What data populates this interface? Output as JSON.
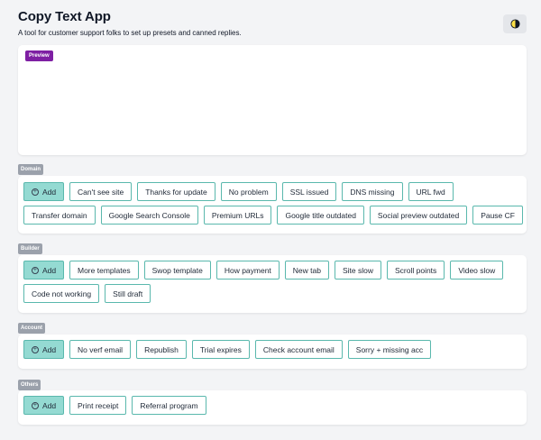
{
  "header": {
    "title": "Copy Text App",
    "subtitle": "A tool for customer support folks to set up presets and canned replies."
  },
  "theme_toggle": {
    "icon": "half-moon-icon"
  },
  "preview": {
    "badge": "Preview",
    "content": ""
  },
  "add_label": "Add",
  "sections": {
    "domain": {
      "label": "Domain",
      "buttons": [
        "Can't see site",
        "Thanks for update",
        "No problem",
        "SSL issued",
        "DNS missing",
        "URL fwd",
        "Transfer domain",
        "Google Search Console",
        "Premium URLs",
        "Google title outdated",
        "Social preview outdated",
        "Pause CF"
      ]
    },
    "builder": {
      "label": "Builder",
      "buttons": [
        "More templates",
        "Swop template",
        "How payment",
        "New tab",
        "Site slow",
        "Scroll points",
        "Video slow",
        "Code not working",
        "Still draft"
      ]
    },
    "account": {
      "label": "Account",
      "buttons": [
        "No verf email",
        "Republish",
        "Trial expires",
        "Check account email",
        "Sorry + missing acc"
      ]
    },
    "others": {
      "label": "Others",
      "buttons": [
        "Print receipt",
        "Referral program"
      ]
    }
  },
  "colors": {
    "accent_fill": "#94dad2",
    "accent_border": "#5ab8ad",
    "preview_badge": "#7e1fa3",
    "section_label": "#9ba1ab",
    "background": "#f3f4f6"
  }
}
